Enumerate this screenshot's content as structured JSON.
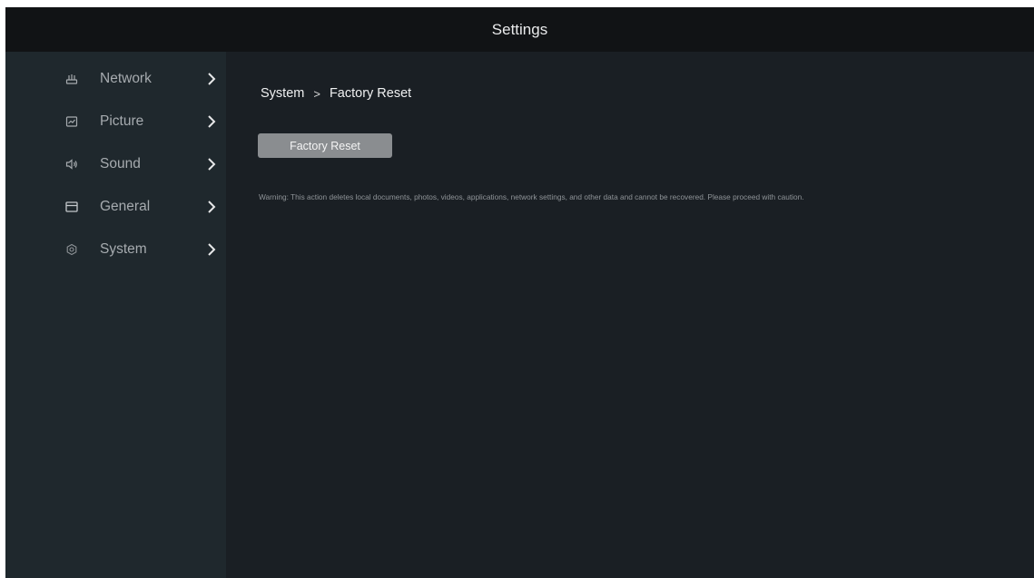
{
  "header": {
    "title": "Settings"
  },
  "sidebar": {
    "items": [
      {
        "label": "Network",
        "icon": "network-icon"
      },
      {
        "label": "Picture",
        "icon": "picture-icon"
      },
      {
        "label": "Sound",
        "icon": "sound-icon"
      },
      {
        "label": "General",
        "icon": "general-icon"
      },
      {
        "label": "System",
        "icon": "system-icon"
      }
    ]
  },
  "main": {
    "breadcrumb": {
      "parent": "System",
      "separator": ">",
      "current": "Factory Reset"
    },
    "reset_button_label": "Factory Reset",
    "warning": "Warning: This action deletes local documents, photos, videos, applications, network settings, and other data and cannot be recovered. Please proceed with caution."
  },
  "colors": {
    "background": "#1a1f24",
    "sidebar": "#1f282d",
    "topbar": "#111315",
    "button": "#8a8d90"
  }
}
